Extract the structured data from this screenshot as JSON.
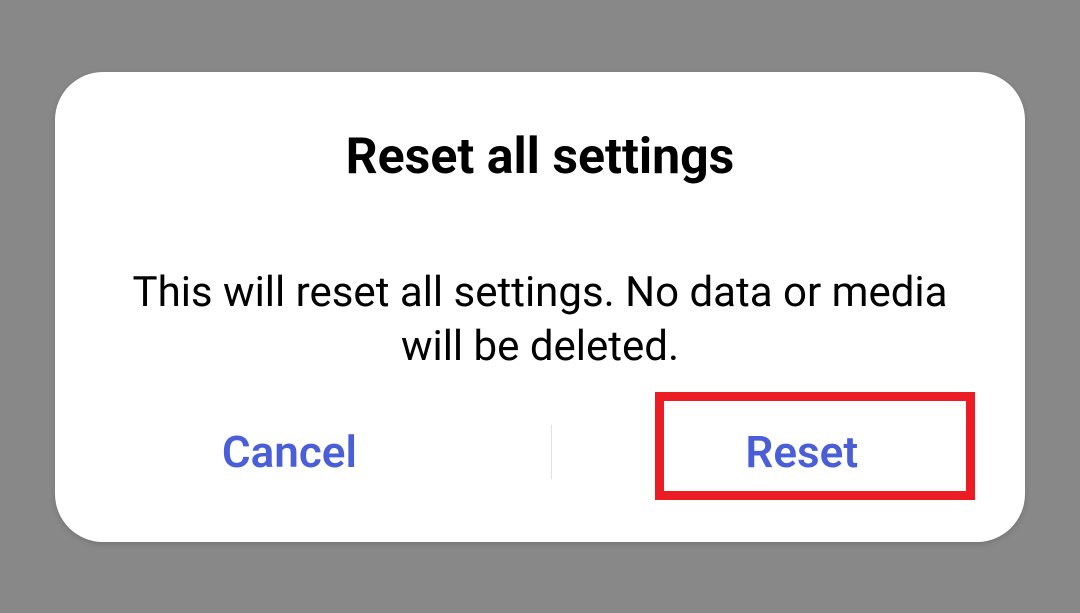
{
  "dialog": {
    "title": "Reset all settings",
    "message": "This will reset all settings. No data or media will be deleted.",
    "cancel_label": "Cancel",
    "confirm_label": "Reset"
  },
  "highlight": {
    "target": "reset-button"
  },
  "colors": {
    "accent": "#4a5fd7",
    "highlight": "#ec1c24",
    "background": "#888888"
  }
}
